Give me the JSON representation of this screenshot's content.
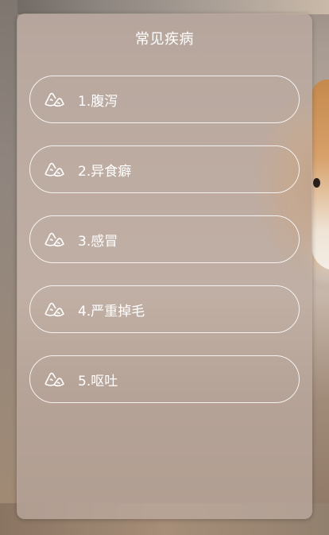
{
  "panel": {
    "title": "常见疾病"
  },
  "items": [
    {
      "label": "1.腹泻",
      "icon": "paw-icon"
    },
    {
      "label": "2.异食癖",
      "icon": "paw-icon"
    },
    {
      "label": "3.感冒",
      "icon": "paw-icon"
    },
    {
      "label": "4.严重掉毛",
      "icon": "paw-icon"
    },
    {
      "label": "5.呕吐",
      "icon": "paw-icon"
    }
  ]
}
